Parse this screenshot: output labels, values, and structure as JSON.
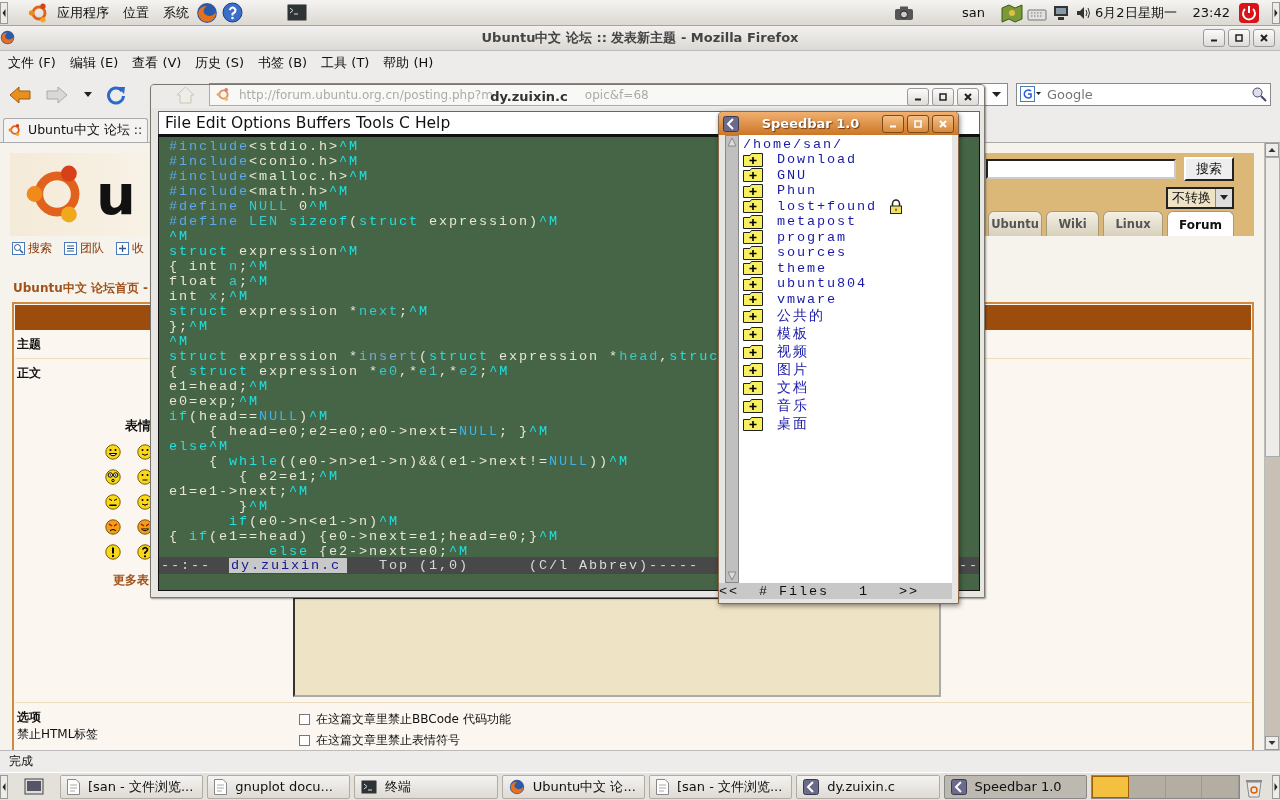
{
  "top_panel": {
    "menus": [
      "应用程序",
      "位置",
      "系统"
    ],
    "user": "san",
    "date": "6月2日星期一",
    "time": "23:42"
  },
  "firefox": {
    "title": "Ubuntu中文 论坛 :: 发表新主题 - Mozilla Firefox",
    "menu": [
      "文件 (F)",
      "编辑 (E)",
      "查看 (V)",
      "历史 (S)",
      "书签 (B)",
      "工具 (T)",
      "帮助 (H)"
    ],
    "url_start": "http://forum.ubuntu.org.cn/posting.php?m",
    "url_end": "opic&f=68",
    "search": {
      "placeholder": "Google"
    },
    "tab": "Ubuntu中文 论坛 ::",
    "page": {
      "logo_text": "u",
      "search_button": "搜索",
      "convert_select": "不转换",
      "site_tabs": [
        {
          "label": "Ubuntu",
          "selected": false
        },
        {
          "label": "Wiki",
          "selected": false
        },
        {
          "label": "Linux",
          "selected": false
        },
        {
          "label": "Forum",
          "selected": true
        }
      ],
      "links": [
        {
          "label": "搜索",
          "kind": "search"
        },
        {
          "label": "团队",
          "kind": "list"
        },
        {
          "label": "收",
          "kind": "add"
        }
      ],
      "breadcrumb": "Ubuntu中文 论坛首页 -",
      "subject_label": "主题",
      "body_label": "正文",
      "smilies_title": "表情",
      "smilies": [
        {
          "kind": "grin"
        },
        {
          "kind": "smile"
        },
        {
          "kind": "eek"
        },
        {
          "kind": "confused"
        },
        {
          "kind": "mad"
        },
        {
          "kind": "razz"
        },
        {
          "kind": "evil"
        },
        {
          "kind": "twisted"
        },
        {
          "kind": "exclaim"
        },
        {
          "kind": "question"
        }
      ],
      "more_smilies": "更多表",
      "options_label": "选项",
      "html_label": "禁止HTML标签",
      "options": [
        {
          "label": "在这篇文章里禁止BBCode 代码功能",
          "checked": false
        },
        {
          "label": "在这篇文章里禁止表情符号",
          "checked": false
        }
      ]
    },
    "status": "完成"
  },
  "emacs": {
    "title": "dy.zuixin.c",
    "menu": [
      "File",
      "Edit",
      "Options",
      "Buffers",
      "Tools",
      "C",
      "Help"
    ],
    "code": [
      [
        {
          "kind": "pre",
          "text": "#include"
        },
        {
          "kind": "text",
          "text": "<stdio.h>"
        },
        {
          "kind": "ctrl",
          "text": "^M"
        }
      ],
      [
        {
          "kind": "pre",
          "text": "#include"
        },
        {
          "kind": "text",
          "text": "<conio.h>"
        },
        {
          "kind": "ctrl",
          "text": "^M"
        }
      ],
      [
        {
          "kind": "pre",
          "text": "#include"
        },
        {
          "kind": "text",
          "text": "<malloc.h>"
        },
        {
          "kind": "ctrl",
          "text": "^M"
        }
      ],
      [
        {
          "kind": "pre",
          "text": "#include"
        },
        {
          "kind": "text",
          "text": "<math.h>"
        },
        {
          "kind": "ctrl",
          "text": "^M"
        }
      ],
      [
        {
          "kind": "pre",
          "text": "#define"
        },
        {
          "kind": "var",
          "text": " NULL"
        },
        {
          "kind": "text",
          "text": " 0"
        },
        {
          "kind": "ctrl",
          "text": "^M"
        }
      ],
      [
        {
          "kind": "pre",
          "text": "#define"
        },
        {
          "kind": "var",
          "text": " LEN"
        },
        {
          "kind": "kw",
          "text": " sizeof"
        },
        {
          "kind": "text",
          "text": "("
        },
        {
          "kind": "kw",
          "text": "struct"
        },
        {
          "kind": "text",
          "text": " expression)"
        },
        {
          "kind": "ctrl",
          "text": "^M"
        }
      ],
      [
        {
          "kind": "ctrl",
          "text": "^M"
        }
      ],
      [
        {
          "kind": "kw",
          "text": "struct"
        },
        {
          "kind": "text",
          "text": " expression"
        },
        {
          "kind": "ctrl",
          "text": "^M"
        }
      ],
      [
        {
          "kind": "text",
          "text": "{ int "
        },
        {
          "kind": "var",
          "text": "n"
        },
        {
          "kind": "text",
          "text": ";"
        },
        {
          "kind": "ctrl",
          "text": "^M"
        }
      ],
      [
        {
          "kind": "text",
          "text": "float "
        },
        {
          "kind": "var",
          "text": "a"
        },
        {
          "kind": "text",
          "text": ";"
        },
        {
          "kind": "ctrl",
          "text": "^M"
        }
      ],
      [
        {
          "kind": "text",
          "text": "int "
        },
        {
          "kind": "var",
          "text": "x"
        },
        {
          "kind": "text",
          "text": ";"
        },
        {
          "kind": "ctrl",
          "text": "^M"
        }
      ],
      [
        {
          "kind": "kw",
          "text": "struct"
        },
        {
          "kind": "text",
          "text": " expression *"
        },
        {
          "kind": "var",
          "text": "next"
        },
        {
          "kind": "text",
          "text": ";"
        },
        {
          "kind": "ctrl",
          "text": "^M"
        }
      ],
      [
        {
          "kind": "text",
          "text": "};"
        },
        {
          "kind": "ctrl",
          "text": "^M"
        }
      ],
      [
        {
          "kind": "ctrl",
          "text": "^M"
        }
      ],
      [
        {
          "kind": "kw",
          "text": "struct"
        },
        {
          "kind": "text",
          "text": " expression *"
        },
        {
          "kind": "fn",
          "text": "insert"
        },
        {
          "kind": "text",
          "text": "("
        },
        {
          "kind": "kw",
          "text": "struct"
        },
        {
          "kind": "text",
          "text": " expression *"
        },
        {
          "kind": "var",
          "text": "head"
        },
        {
          "kind": "text",
          "text": ","
        },
        {
          "kind": "kw",
          "text": "struc"
        }
      ],
      [
        {
          "kind": "text",
          "text": "{ "
        },
        {
          "kind": "kw",
          "text": "struct"
        },
        {
          "kind": "text",
          "text": " expression *"
        },
        {
          "kind": "var",
          "text": "e0"
        },
        {
          "kind": "text",
          "text": ",*"
        },
        {
          "kind": "var",
          "text": "e1"
        },
        {
          "kind": "text",
          "text": ",*"
        },
        {
          "kind": "var",
          "text": "e2"
        },
        {
          "kind": "text",
          "text": ";"
        },
        {
          "kind": "ctrl",
          "text": "^M"
        }
      ],
      [
        {
          "kind": "text",
          "text": "e1=head;"
        },
        {
          "kind": "ctrl",
          "text": "^M"
        }
      ],
      [
        {
          "kind": "text",
          "text": "e0=exp;"
        },
        {
          "kind": "ctrl",
          "text": "^M"
        }
      ],
      [
        {
          "kind": "kw",
          "text": "if"
        },
        {
          "kind": "text",
          "text": "(head=="
        },
        {
          "kind": "const",
          "text": "NULL"
        },
        {
          "kind": "text",
          "text": ")"
        },
        {
          "kind": "ctrl",
          "text": "^M"
        }
      ],
      [
        {
          "kind": "text",
          "text": "    { head=e0;e2=e0;e0->next="
        },
        {
          "kind": "const",
          "text": "NULL"
        },
        {
          "kind": "text",
          "text": "; }"
        },
        {
          "kind": "ctrl",
          "text": "^M"
        }
      ],
      [
        {
          "kind": "kw",
          "text": "else"
        },
        {
          "kind": "ctrl",
          "text": "^M"
        }
      ],
      [
        {
          "kind": "text",
          "text": "    { "
        },
        {
          "kind": "kw",
          "text": "while"
        },
        {
          "kind": "text",
          "text": "((e0->n>e1->n)&&(e1->next!="
        },
        {
          "kind": "const",
          "text": "NULL"
        },
        {
          "kind": "text",
          "text": "))"
        },
        {
          "kind": "ctrl",
          "text": "^M"
        }
      ],
      [
        {
          "kind": "text",
          "text": "       { e2=e1;"
        },
        {
          "kind": "ctrl",
          "text": "^M"
        }
      ],
      [
        {
          "kind": "text",
          "text": "e1=e1->next;"
        },
        {
          "kind": "ctrl",
          "text": "^M"
        }
      ],
      [
        {
          "kind": "text",
          "text": "       }"
        },
        {
          "kind": "ctrl",
          "text": "^M"
        }
      ],
      [
        {
          "kind": "kw",
          "text": "      if"
        },
        {
          "kind": "text",
          "text": "(e0->n<e1->n)"
        },
        {
          "kind": "ctrl",
          "text": "^M"
        }
      ],
      [
        {
          "kind": "text",
          "text": "{ "
        },
        {
          "kind": "kw",
          "text": "if"
        },
        {
          "kind": "text",
          "text": "(e1==head) {e0->next=e1;head=e0;}"
        },
        {
          "kind": "ctrl",
          "text": "^M"
        }
      ],
      [
        {
          "kind": "kw",
          "text": "          else"
        },
        {
          "kind": "text",
          "text": " {e2->next=e0;"
        },
        {
          "kind": "ctrl",
          "text": "^M"
        }
      ]
    ],
    "mode_line": {
      "flags": "--:--",
      "buffer": "dy.zuixin.c",
      "position": "Top (1,0)",
      "modes": "(C/l Abbrev)-----",
      "tail": "--"
    }
  },
  "speedbar": {
    "title": "Speedbar 1.0",
    "path": "/home/san/",
    "items": [
      {
        "name": "Download",
        "kind": "folder"
      },
      {
        "name": "GNU",
        "kind": "folder"
      },
      {
        "name": "Phun",
        "kind": "folder"
      },
      {
        "name": "lost+found",
        "kind": "locked"
      },
      {
        "name": "metapost",
        "kind": "folder"
      },
      {
        "name": "program",
        "kind": "folder"
      },
      {
        "name": "sources",
        "kind": "folder"
      },
      {
        "name": "theme",
        "kind": "folder"
      },
      {
        "name": "ubuntu804",
        "kind": "folder"
      },
      {
        "name": "vmware",
        "kind": "folder"
      },
      {
        "name": "公共的",
        "kind": "folder"
      },
      {
        "name": "模板",
        "kind": "folder"
      },
      {
        "name": "视频",
        "kind": "folder"
      },
      {
        "name": "图片",
        "kind": "folder"
      },
      {
        "name": "文档",
        "kind": "folder"
      },
      {
        "name": "音乐",
        "kind": "folder"
      },
      {
        "name": "桌面",
        "kind": "folder"
      }
    ],
    "footer": "<<  # Files   1   >>"
  },
  "taskbar": {
    "buttons": [
      {
        "label": "[san - 文件浏览...",
        "kind": "files",
        "selected": false
      },
      {
        "label": "gnuplot docu...",
        "kind": "document",
        "selected": false
      },
      {
        "label": "终端",
        "kind": "terminal",
        "selected": false
      },
      {
        "label": "Ubuntu中文  论...",
        "kind": "browser",
        "selected": false
      },
      {
        "label": "[san - 文件浏览...",
        "kind": "files",
        "selected": false
      },
      {
        "label": "dy.zuixin.c",
        "kind": "emacs",
        "selected": false
      },
      {
        "label": "Speedbar 1.0",
        "kind": "emacs",
        "selected": true
      }
    ]
  }
}
